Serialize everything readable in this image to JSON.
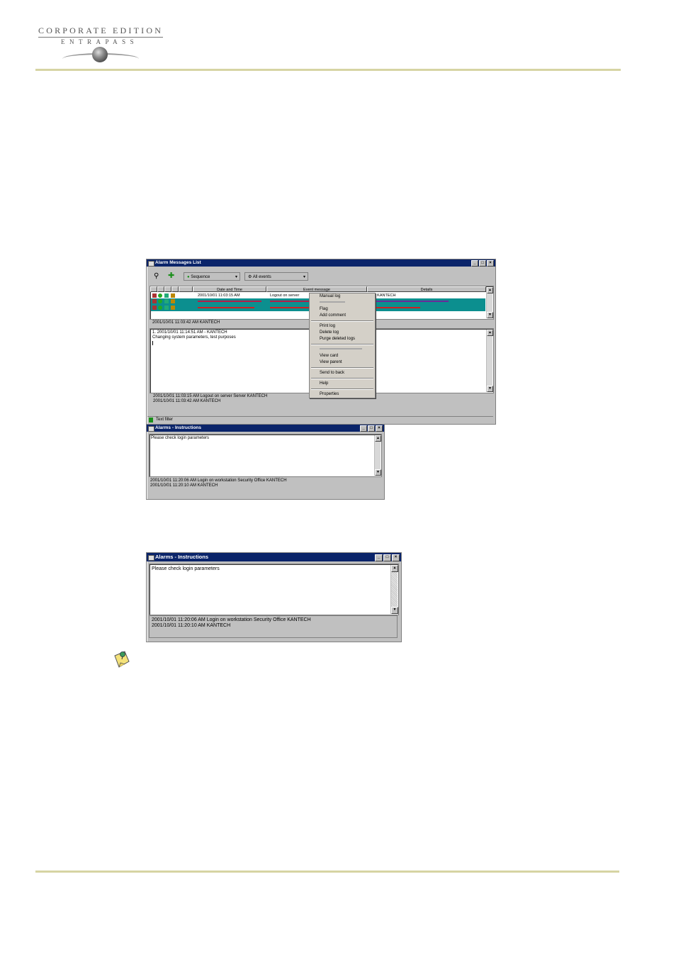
{
  "logo": {
    "top": "CORPORATE EDITION",
    "bottom": "ENTRAPASS"
  },
  "alarm_window": {
    "title": "Alarm Messages List",
    "toolbar": {
      "sequence": "Sequence",
      "filter": "All events"
    },
    "columns": [
      "Date and Time",
      "Event message",
      "Details"
    ],
    "rows": [
      {
        "datetime": "2001/10/01 11:03:15 AM",
        "message": "Logout on server",
        "details": "ver KANTECH"
      }
    ],
    "selected_entry": "2001/10/01 11:03:42 AM    KANTECH",
    "comment_lines": [
      "1. 2001/10/01 11:14:51 AM - KANTECH",
      "Changing system parameters, test purposes"
    ],
    "footer_lines": [
      "2001/10/01 11:03:15 AM  Logout on server  Server KANTECH",
      "2001/10/01 11:03:42 AM    KANTECH"
    ],
    "status": "Text filter",
    "context_menu": {
      "items": [
        {
          "label": "Manual log",
          "disabled": false
        },
        {
          "label": "",
          "disabled": true
        },
        {
          "label": "Flag",
          "disabled": false
        },
        {
          "label": "Add comment",
          "disabled": false
        },
        {
          "sep": true
        },
        {
          "label": "Print log",
          "disabled": false
        },
        {
          "label": "Delete log",
          "disabled": false
        },
        {
          "label": "Purge deleted logs",
          "disabled": false
        },
        {
          "sep": true
        },
        {
          "label": "",
          "disabled": true
        },
        {
          "label": "View card",
          "disabled": false
        },
        {
          "label": "View parent",
          "disabled": false
        },
        {
          "sep": true
        },
        {
          "label": "Send to back",
          "disabled": false
        },
        {
          "sep": true
        },
        {
          "label": "Help",
          "disabled": false
        },
        {
          "sep": true
        },
        {
          "label": "Properties",
          "disabled": false
        }
      ]
    }
  },
  "instructions_small": {
    "title": "Alarms - Instructions",
    "body": "Please check login parameters",
    "footer_lines": [
      "2001/10/01 11:20:06 AM  Login on workstation  Security Office  KANTECH",
      "2001/10/01 11:20:10 AM    KANTECH"
    ]
  },
  "instructions_large": {
    "title": "Alarms - Instructions",
    "body": "Please check login parameters",
    "footer_lines": [
      "2001/10/01 11:20:06 AM  Login on workstation  Security Office  KANTECH",
      "2001/10/01 11:20:10 AM    KANTECH"
    ]
  },
  "colors": {
    "rule": "#d6d4a3",
    "titlebar": "#0a246a",
    "selection": "#0c8f8f",
    "alarm_text": "#cc0000"
  }
}
